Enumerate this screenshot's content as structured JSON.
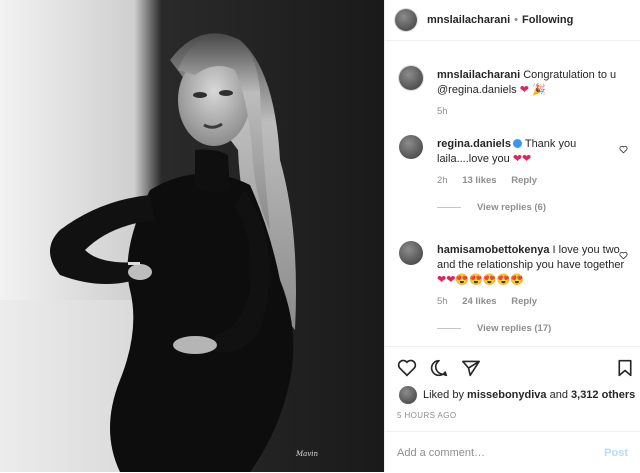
{
  "post": {
    "author": "mnslailacharani",
    "separator": "•",
    "follow_state": "Following",
    "photo_watermark": "Mavin"
  },
  "comments": [
    {
      "username": "mnslailacharani",
      "text": "Congratulation to u @regina.daniels",
      "emoji": "❤ 🎉",
      "time": "5h"
    },
    {
      "username": "regina.daniels",
      "verified": true,
      "text": "Thank you laila....love you",
      "emoji": "❤❤",
      "time": "2h",
      "likes": "13 likes",
      "reply": "Reply",
      "view_replies": "View replies (6)"
    },
    {
      "username": "hamisamobettokenya",
      "text": "I love you two and the relationship you have together",
      "emoji": "❤❤😍😍😍😍😍",
      "time": "5h",
      "likes": "24 likes",
      "reply": "Reply",
      "view_replies": "View replies (17)"
    }
  ],
  "liked_by": {
    "prefix": "Liked by",
    "user": "missebonydiva",
    "and": "and",
    "others": "3,312 others"
  },
  "time_ago": "5 HOURS AGO",
  "comment_box": {
    "placeholder": "Add a comment…",
    "post_label": "Post"
  },
  "icons": [
    "heart-icon",
    "comment-icon",
    "share-icon",
    "bookmark-icon"
  ],
  "colors": {
    "heart": "#e0245e",
    "verified": "#3897f0",
    "post_disabled": "#b3dbff"
  }
}
